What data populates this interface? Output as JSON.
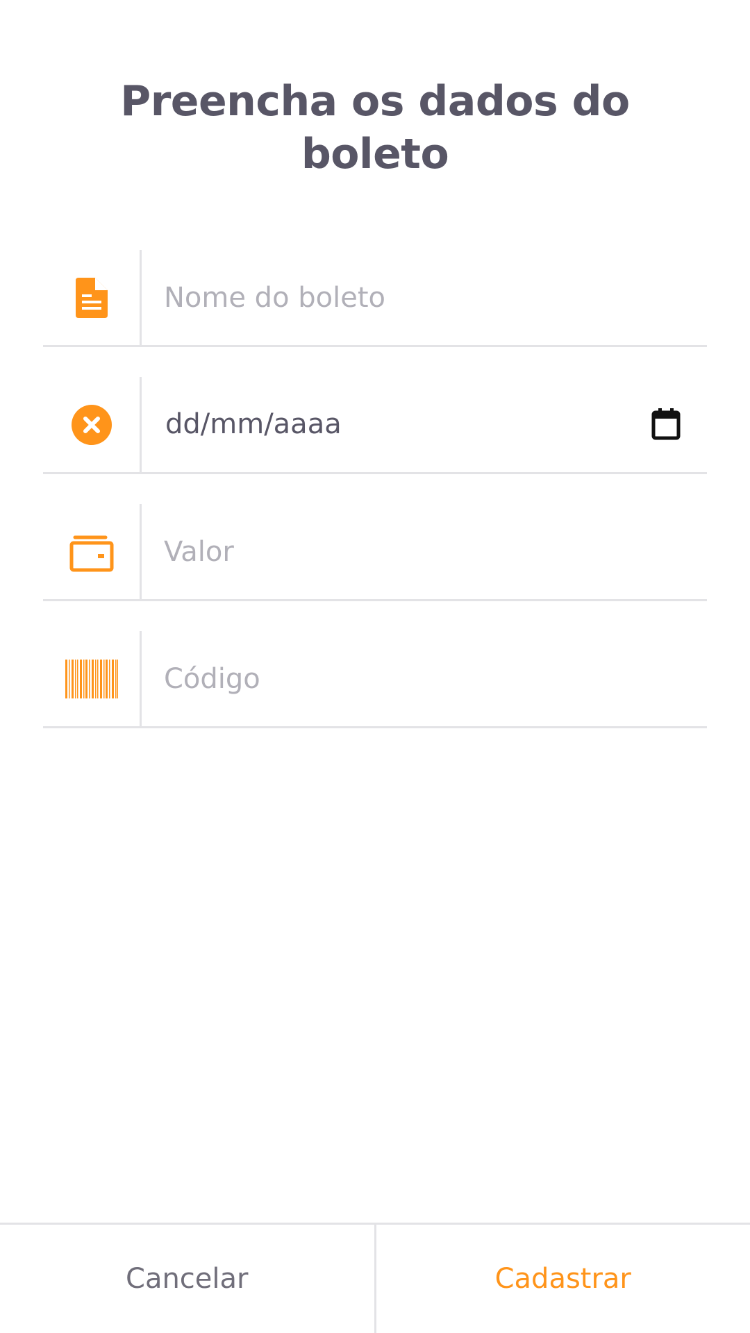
{
  "page": {
    "title_line1": "Preencha os dados do",
    "title_line2": "boleto"
  },
  "form": {
    "name": {
      "placeholder": "Nome do boleto",
      "value": "",
      "icon": "file-text-icon"
    },
    "due_date": {
      "placeholder": "dd/mm/aaaa",
      "value": "",
      "icon": "x-circle-icon",
      "picker_icon": "calendar-icon"
    },
    "amount": {
      "placeholder": "Valor",
      "value": "",
      "icon": "wallet-icon"
    },
    "code": {
      "placeholder": "Código",
      "value": "",
      "icon": "barcode-icon"
    }
  },
  "footer": {
    "cancel_label": "Cancelar",
    "submit_label": "Cadastrar"
  },
  "colors": {
    "accent": "#FF941A",
    "heading": "#585666",
    "placeholder": "#B1B0B8",
    "divider": "#E3E3E6",
    "secondary_text": "#706E7A"
  }
}
